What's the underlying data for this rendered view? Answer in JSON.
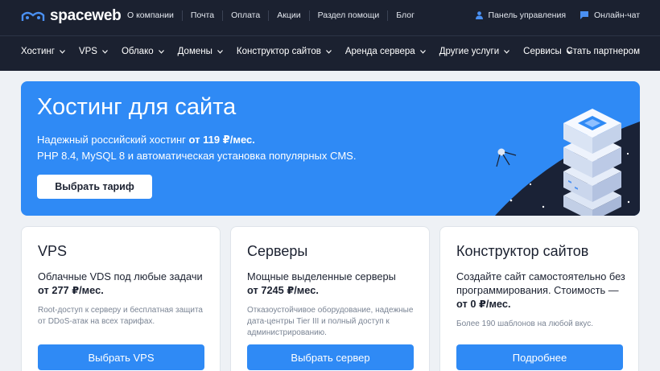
{
  "brand": {
    "name": "spaceweb"
  },
  "topnav": [
    "О компании",
    "Почта",
    "Оплата",
    "Акции",
    "Раздел помощи",
    "Блог"
  ],
  "topright": {
    "panel": "Панель управления",
    "chat": "Онлайн-чат"
  },
  "mainnav": [
    "Хостинг",
    "VPS",
    "Облако",
    "Домены",
    "Конструктор сайтов",
    "Аренда сервера",
    "Другие услуги",
    "Сервисы"
  ],
  "partner": "Стать партнером",
  "hero": {
    "title": "Хостинг для сайта",
    "line1_prefix": "Надежный российский хостинг",
    "line1_price": "от 119 ₽/мес.",
    "line2": "PHP 8.4, MySQL 8 и автоматическая установка популярных CMS.",
    "button": "Выбрать тариф"
  },
  "cards": [
    {
      "title": "VPS",
      "desc": "Облачные VDS под любые задачи",
      "price": "от 277 ₽/мес.",
      "note": "Root-доступ к серверу и бесплатная защита от DDoS-атак на всех тарифах.",
      "button": "Выбрать VPS"
    },
    {
      "title": "Серверы",
      "desc": "Мощные выделенные серверы",
      "price": "от 7245 ₽/мес.",
      "note": "Отказоустойчивое оборудование, надежные дата-центры Tier III и полный доступ к администрированию.",
      "button": "Выбрать сервер"
    },
    {
      "title": "Конструктор сайтов",
      "desc": "Создайте сайт самостоятельно без программирования. Стоимость —",
      "price": "от 0 ₽/мес.",
      "note": "Более 190 шаблонов на любой вкус.",
      "button": "Подробнее"
    }
  ],
  "colors": {
    "header_bg": "#1b2130",
    "accent": "#2f8af5",
    "page_bg": "#eef1f5"
  }
}
